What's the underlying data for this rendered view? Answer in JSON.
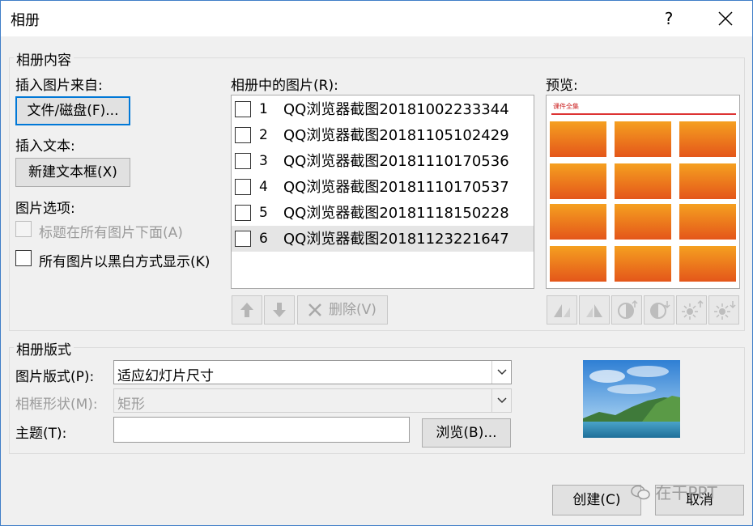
{
  "window": {
    "title": "相册",
    "help": "?",
    "close": "✕"
  },
  "content_group": {
    "title": "相册内容",
    "insert_from_label": "插入图片来自:",
    "file_disk_button": "文件/磁盘(F)...",
    "insert_text_label": "插入文本:",
    "new_textbox_button": "新建文本框(X)",
    "picture_options_label": "图片选项:",
    "caption_below_option": "标题在所有图片下面(A)",
    "black_white_option": "所有图片以黑白方式显示(K)",
    "pictures_label": "相册中的图片(R):",
    "pictures": [
      {
        "num": "1",
        "name": "QQ浏览器截图20181002233344"
      },
      {
        "num": "2",
        "name": "QQ浏览器截图20181105102429"
      },
      {
        "num": "3",
        "name": "QQ浏览器截图20181110170536"
      },
      {
        "num": "4",
        "name": "QQ浏览器截图20181110170537"
      },
      {
        "num": "5",
        "name": "QQ浏览器截图20181118150228"
      },
      {
        "num": "6",
        "name": "QQ浏览器截图20181123221647"
      }
    ],
    "delete_button": "删除(V)",
    "preview_label": "预览:",
    "preview_header": "课件全集"
  },
  "layout_group": {
    "title": "相册版式",
    "picture_layout_label": "图片版式(P):",
    "picture_layout_value": "适应幻灯片尺寸",
    "frame_shape_label": "相框形状(M):",
    "frame_shape_value": "矩形",
    "theme_label": "主题(T):",
    "theme_value": "",
    "browse_button": "浏览(B)..."
  },
  "footer": {
    "create_button": "创建(C)",
    "cancel_button": "取消"
  },
  "watermark": "在干PPT",
  "colors": {
    "accent": "#0078d7",
    "tile": "#f07a10"
  }
}
